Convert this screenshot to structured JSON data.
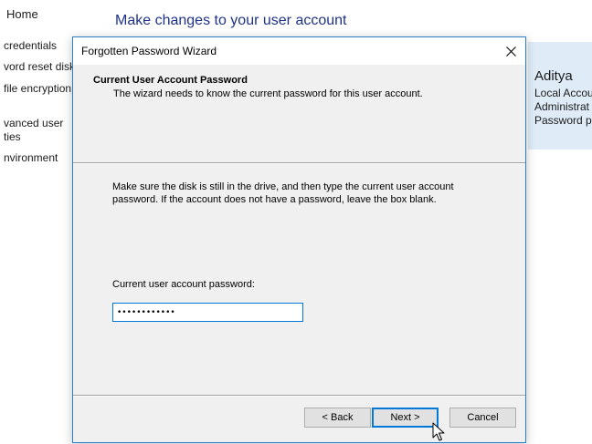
{
  "background": {
    "home_link": "Home",
    "heading": "Make changes to your user account",
    "left_links": [
      "credentials",
      "vord reset disk",
      "file encryption",
      "vanced user",
      "ties",
      "nvironment"
    ],
    "account": {
      "name": "Aditya",
      "details": [
        "Local Accou",
        "Administrat",
        "Password p"
      ]
    }
  },
  "dialog": {
    "title": "Forgotten Password Wizard",
    "header_title": "Current User Account Password",
    "header_subtitle": "The wizard needs to know the current password for this user account.",
    "instruction": "Make sure the disk is still in the drive, and then type the current user account password. If the account does not have a password, leave the box blank.",
    "password_label": "Current user account password:",
    "password_value": "••••••••••••",
    "buttons": {
      "back": "< Back",
      "next": "Next >",
      "cancel": "Cancel"
    }
  },
  "colors": {
    "accent": "#0078d7",
    "heading": "#1e3287",
    "account_panel": "#dfecf8",
    "dialog_bg": "#f0f0f0"
  }
}
